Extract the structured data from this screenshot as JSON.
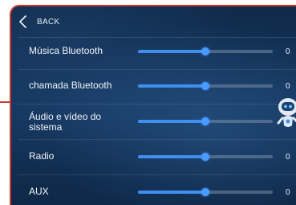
{
  "header": {
    "back_label": "BACK"
  },
  "rows": [
    {
      "label": "Música Bluetooth",
      "value": "0",
      "level": 0.5
    },
    {
      "label": "chamada Bluetooth",
      "value": "0",
      "level": 0.5
    },
    {
      "label": "Áudio e vídeo do sistema",
      "value": "0",
      "level": 0.5
    },
    {
      "label": "Radio",
      "value": "0",
      "level": 0.5
    },
    {
      "label": "AUX",
      "value": "0",
      "level": 0.5
    }
  ],
  "colors": {
    "accent": "#3f8ff0",
    "frame": "#c8342e",
    "background": "#14375f"
  },
  "icons": {
    "back": "chevron-left-icon",
    "assistant": "robot-icon"
  }
}
